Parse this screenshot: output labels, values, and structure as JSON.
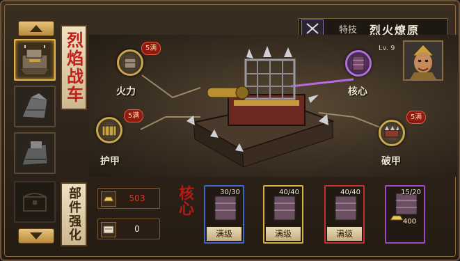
{
  "left_nav": {
    "up_icon": "triangle-up",
    "down_icon": "triangle-down"
  },
  "title_vertical": "烈焰战车",
  "parts_vertical": "部件强化",
  "skill": {
    "label": "特技",
    "name": "烈火燎原"
  },
  "nodes": [
    {
      "key": "firepower",
      "label": "火力",
      "badge": "5满"
    },
    {
      "key": "armor",
      "label": "护甲",
      "badge": "5满"
    },
    {
      "key": "core",
      "label": "核心",
      "badge": ""
    },
    {
      "key": "break",
      "label": "破甲",
      "badge": "5满"
    }
  ],
  "general": {
    "level": "Lv. 9"
  },
  "resources": [
    {
      "key": "gold",
      "value": "503",
      "color": "#d23a2a"
    },
    {
      "key": "scroll",
      "value": "0",
      "color": "#f2ead8"
    }
  ],
  "core_label": "核心",
  "parts": [
    {
      "count": "30/30",
      "status": "满级",
      "frame": "#3f68c9"
    },
    {
      "count": "40/40",
      "status": "满级",
      "frame": "#d4b23c"
    },
    {
      "count": "40/40",
      "status": "满级",
      "frame": "#c23030"
    },
    {
      "count": "15/20",
      "cost": "400",
      "frame": "#a04ac8"
    }
  ],
  "colors": {
    "accent_gold": "#e5b445",
    "core_purple": "#b070d8",
    "title_red": "#c0201a"
  }
}
